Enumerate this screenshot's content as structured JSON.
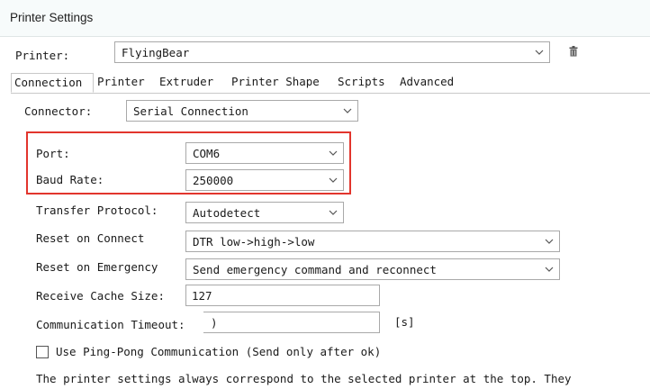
{
  "window": {
    "title": "Printer Settings"
  },
  "printer": {
    "label": "Printer:",
    "value": "FlyingBear",
    "delete_icon": "trash-icon"
  },
  "tabs": [
    {
      "label": "Connection"
    },
    {
      "label": "Printer"
    },
    {
      "label": "Extruder"
    },
    {
      "label": "Printer Shape"
    },
    {
      "label": "Scripts"
    },
    {
      "label": "Advanced"
    }
  ],
  "connection": {
    "connector_label": "Connector:",
    "connector_value": "Serial Connection",
    "port_label": "Port:",
    "port_value": "COM6",
    "baud_label": "Baud Rate:",
    "baud_value": "250000",
    "protocol_label": "Transfer Protocol:",
    "protocol_value": "Autodetect",
    "reset_connect_label": "Reset on Connect",
    "reset_connect_value": "DTR low->high->low",
    "reset_emergency_label": "Reset on Emergency",
    "reset_emergency_value": "Send emergency command and reconnect",
    "cache_label": "Receive Cache Size:",
    "cache_value": "127",
    "timeout_label": "Communication Timeout:",
    "timeout_value": ")",
    "timeout_unit": "[s]",
    "pingpong_label": "Use Ping-Pong Communication (Send only after ok)",
    "note": "The printer settings always correspond to the selected printer at the top. They"
  },
  "colors": {
    "highlight": "#e2352d"
  }
}
